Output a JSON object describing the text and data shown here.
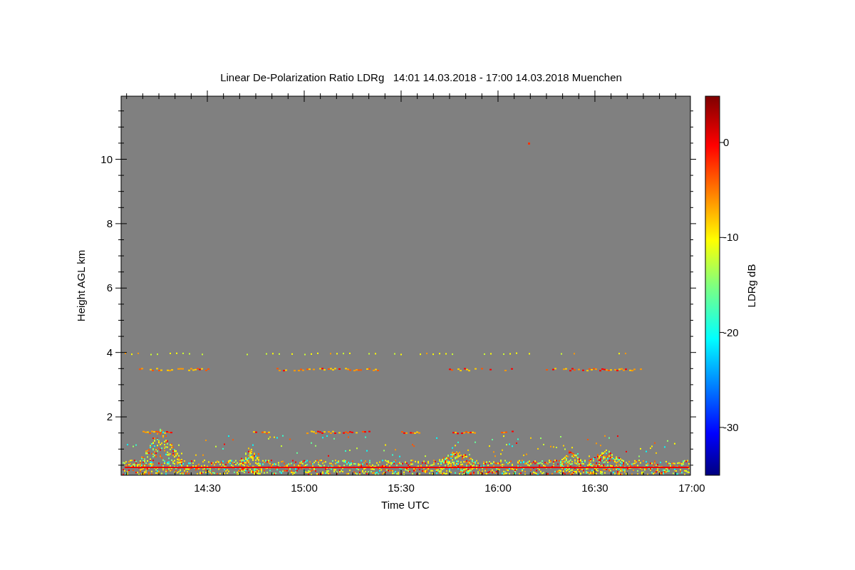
{
  "title": "Linear De-Polarization Ratio LDRg   14:01 14.03.2018 - 17:00 14.03.2018 Muenchen",
  "xlabel": "Time UTC",
  "ylabel": "Height AGL km",
  "xticks": [
    "14:30",
    "15:00",
    "15:30",
    "16:00",
    "16:30",
    "17:00"
  ],
  "yticks": [
    "10",
    "8",
    "6",
    "4",
    "2"
  ],
  "colorbar": {
    "label": "LDRg dB",
    "ticks": [
      "0",
      "-10",
      "-20",
      "-30"
    ]
  }
}
